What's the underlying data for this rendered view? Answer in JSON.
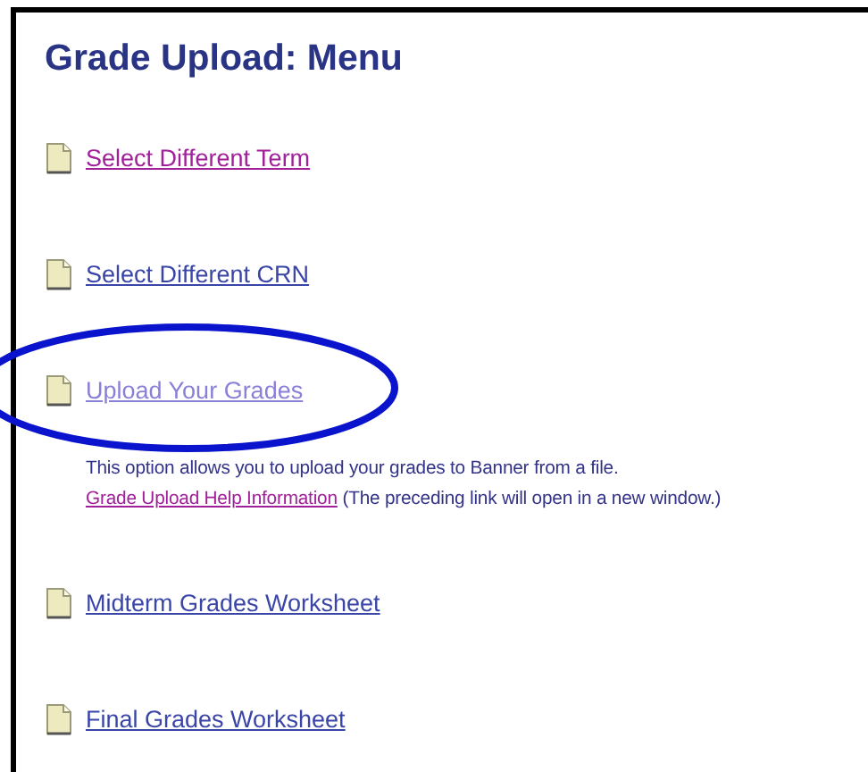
{
  "page": {
    "title": "Grade Upload: Menu"
  },
  "menu_items": [
    {
      "label": "Select Different Term",
      "visited": true
    },
    {
      "label": "Select Different CRN",
      "visited": false
    },
    {
      "label": "Upload Your Grades",
      "visited": false,
      "highlighted": true,
      "description": "This option allows you to upload your grades to Banner from a file.",
      "help_link": {
        "label": "Grade Upload Help Information",
        "visited": true
      },
      "help_note": "(The preceding link will open in a new window.)"
    },
    {
      "label": "Midterm Grades Worksheet",
      "visited": false
    },
    {
      "label": "Final Grades Worksheet",
      "visited": false
    }
  ]
}
